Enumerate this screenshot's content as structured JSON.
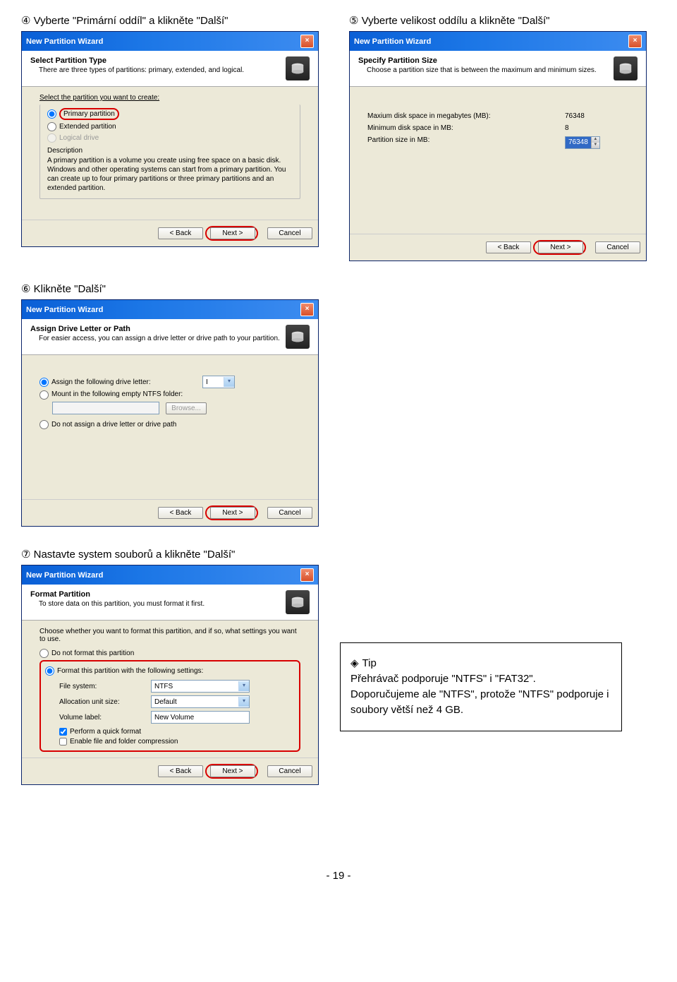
{
  "step4_label": "④ Vyberte \"Primární oddíl\" a klikněte \"Další\"",
  "step5_label": "⑤ Vyberte velikost oddílu a klikněte \"Další\"",
  "step6_label": "⑥ Klikněte \"Další\"",
  "step7_label": "⑦ Nastavte system souborů a klikněte \"Další\"",
  "wizard_title": "New Partition Wizard",
  "w4": {
    "title": "Select Partition Type",
    "sub": "There are three types of partitions: primary, extended, and logical.",
    "prompt": "Select the partition you want to create:",
    "opt_primary": "Primary partition",
    "opt_extended": "Extended partition",
    "opt_logical": "Logical drive",
    "desc_label": "Description",
    "desc": "A primary partition is a volume you create using free space on a basic disk. Windows and other operating systems can start from a primary partition. You can create up to four primary partitions or three primary partitions and an extended partition."
  },
  "w5": {
    "title": "Specify Partition Size",
    "sub": "Choose a partition size that is between the maximum and minimum sizes.",
    "max_label": "Maxium disk space in megabytes (MB):",
    "max_val": "76348",
    "min_label": "Minimum disk space in MB:",
    "min_val": "8",
    "size_label": "Partition size in MB:",
    "size_val": "76348"
  },
  "w6": {
    "title": "Assign Drive Letter or Path",
    "sub": "For easier access, you can assign a drive letter or drive path to your partition.",
    "opt_assign": "Assign the following drive letter:",
    "letter": "I",
    "opt_mount": "Mount in the following empty NTFS folder:",
    "browse": "Browse...",
    "opt_none": "Do not assign a drive letter or drive path"
  },
  "w7": {
    "title": "Format Partition",
    "sub": "To store data on this partition, you must format it first.",
    "prompt": "Choose whether you want to format this partition, and if so, what settings you want to use.",
    "opt_noformat": "Do not format this partition",
    "opt_format": "Format this partition with the following settings:",
    "fs_label": "File system:",
    "fs_val": "NTFS",
    "alloc_label": "Allocation unit size:",
    "alloc_val": "Default",
    "vol_label": "Volume label:",
    "vol_val": "New Volume",
    "quick": "Perform a quick format",
    "compress": "Enable file and folder compression"
  },
  "buttons": {
    "back": "< Back",
    "next": "Next >",
    "cancel": "Cancel"
  },
  "tip": {
    "title": "Tip",
    "line1": "Přehrávač podporuje \"NTFS\" i \"FAT32\".",
    "line2": "Doporučujeme ale \"NTFS\", protože \"NTFS\" podporuje i soubory větší než 4 GB."
  },
  "page_number": "- 19 -"
}
